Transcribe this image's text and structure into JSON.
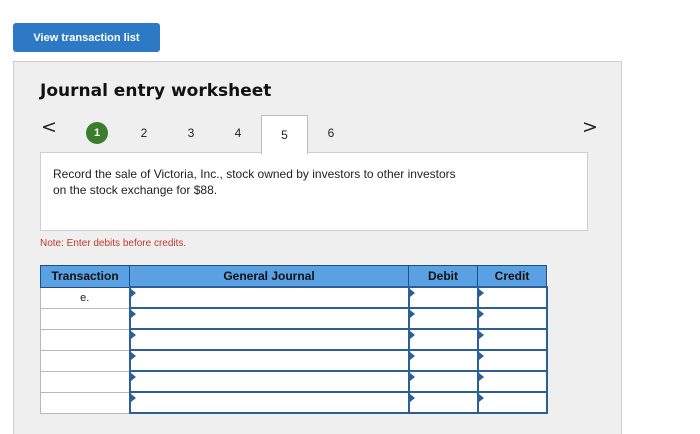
{
  "view_button": {
    "label": "View transaction list"
  },
  "worksheet": {
    "title": "Journal entry worksheet",
    "nav": {
      "prev_icon": "chevron-left-icon",
      "next_icon": "chevron-right-icon",
      "prev": "<",
      "next": ">"
    },
    "steps": [
      {
        "label": "1",
        "state": "completed"
      },
      {
        "label": "2",
        "state": "normal"
      },
      {
        "label": "3",
        "state": "normal"
      },
      {
        "label": "4",
        "state": "normal"
      },
      {
        "label": "5",
        "state": "active"
      },
      {
        "label": "6",
        "state": "normal"
      }
    ],
    "description_line1": "Record the sale of Victoria, Inc., stock owned by investors to other investors",
    "description_line2": "on the stock exchange for $88.",
    "note": "Note: Enter debits before credits.",
    "colors": {
      "accent": "#2e79c5",
      "header": "#5aa1e3",
      "completed": "#3a7d2c",
      "note": "#c0392b"
    }
  },
  "journal": {
    "headers": [
      "Transaction",
      "General Journal",
      "Debit",
      "Credit"
    ],
    "rows": [
      {
        "transaction": "e.",
        "account": "",
        "debit": "",
        "credit": ""
      },
      {
        "transaction": "",
        "account": "",
        "debit": "",
        "credit": ""
      },
      {
        "transaction": "",
        "account": "",
        "debit": "",
        "credit": ""
      },
      {
        "transaction": "",
        "account": "",
        "debit": "",
        "credit": ""
      },
      {
        "transaction": "",
        "account": "",
        "debit": "",
        "credit": ""
      },
      {
        "transaction": "",
        "account": "",
        "debit": "",
        "credit": ""
      }
    ]
  }
}
